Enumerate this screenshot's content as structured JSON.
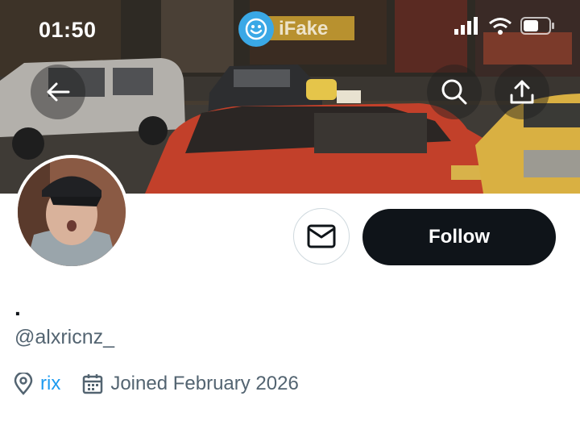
{
  "status_bar": {
    "time": "01:50",
    "watermark": "iFake"
  },
  "header": {
    "back_icon": "arrow-left-icon",
    "search_icon": "search-icon",
    "share_icon": "share-upload-icon"
  },
  "profile": {
    "display_name": ".",
    "handle": "@alxricnz_",
    "location": "rix",
    "joined": "Joined February 2026"
  },
  "actions": {
    "message_icon": "envelope-icon",
    "follow_label": "Follow"
  },
  "colors": {
    "follow_bg": "#0f1419",
    "link": "#1d9bf0",
    "secondary_text": "#536471"
  }
}
